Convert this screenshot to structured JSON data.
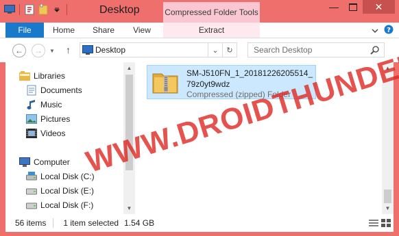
{
  "window": {
    "title": "Desktop",
    "contextual_tab_group": "Compressed Folder Tools",
    "accent_color": "#ef6f6c",
    "file_tab_color": "#1979ca"
  },
  "ribbon": {
    "tabs": [
      {
        "label": "File"
      },
      {
        "label": "Home"
      },
      {
        "label": "Share"
      },
      {
        "label": "View"
      },
      {
        "label": "Extract"
      }
    ]
  },
  "address": {
    "path": "Desktop",
    "search_placeholder": "Search Desktop"
  },
  "nav": {
    "items": [
      {
        "label": "Libraries",
        "icon": "libraries-icon"
      },
      {
        "label": "Documents",
        "icon": "documents-icon"
      },
      {
        "label": "Music",
        "icon": "music-icon"
      },
      {
        "label": "Pictures",
        "icon": "pictures-icon"
      },
      {
        "label": "Videos",
        "icon": "videos-icon"
      },
      {
        "label": "Computer",
        "icon": "computer-icon"
      },
      {
        "label": "Local Disk (C:)",
        "icon": "drive-icon"
      },
      {
        "label": "Local Disk (E:)",
        "icon": "drive-icon"
      },
      {
        "label": "Local Disk (F:)",
        "icon": "drive-icon"
      }
    ]
  },
  "files": [
    {
      "name": "SM-J510FN_1_20181226205514_79z0yt9wdz",
      "type": "Compressed (zipped) Folder",
      "icon": "zip-folder-icon"
    }
  ],
  "status": {
    "item_count": "56 items",
    "selection": "1 item selected",
    "size": "1.54 GB"
  },
  "watermark": "WWW.DROIDTHUNDER.COM"
}
